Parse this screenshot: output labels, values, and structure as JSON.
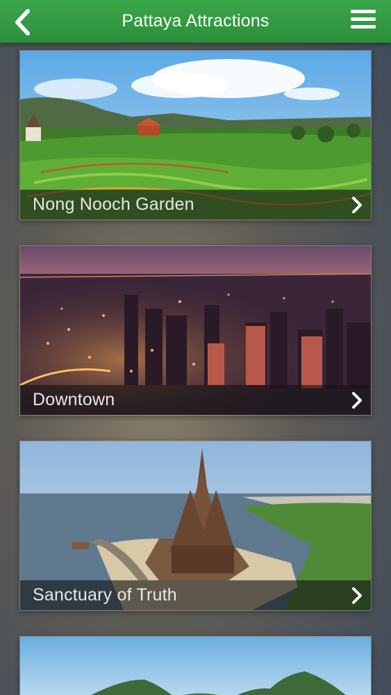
{
  "header": {
    "title": "Pattaya Attractions",
    "back_icon": "chevron-left-icon",
    "menu_icon": "hamburger-menu-icon",
    "color": "#33a043"
  },
  "attractions": [
    {
      "label": "Nong Nooch Garden",
      "icon": "chevron-right-icon"
    },
    {
      "label": "Downtown",
      "icon": "chevron-right-icon"
    },
    {
      "label": "Sanctuary of Truth",
      "icon": "chevron-right-icon"
    },
    {
      "label": "",
      "icon": ""
    }
  ]
}
